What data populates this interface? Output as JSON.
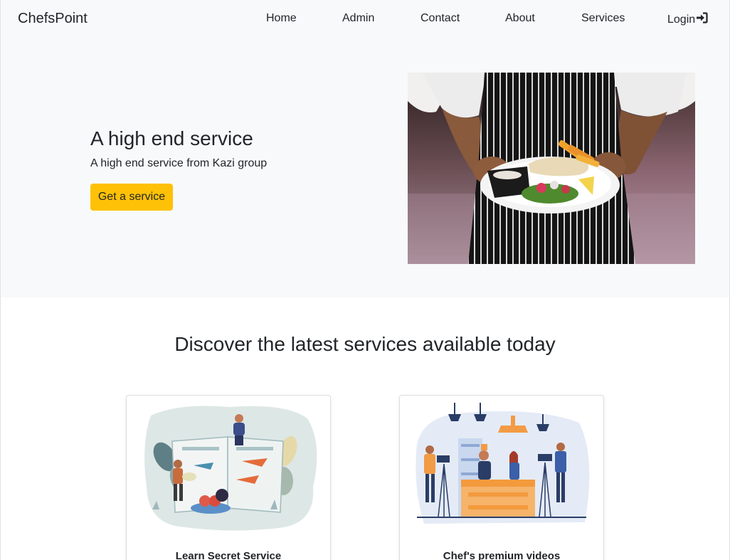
{
  "navbar": {
    "brand": "ChefsPoint",
    "items": [
      {
        "label": "Home"
      },
      {
        "label": "Admin"
      },
      {
        "label": "Contact"
      },
      {
        "label": "About"
      },
      {
        "label": "Services"
      },
      {
        "label": "Login",
        "icon": "sign-in-icon"
      }
    ]
  },
  "hero": {
    "title": "A high end service",
    "subtitle": "A high end service from Kazi group",
    "button_label": "Get a service",
    "image": "chef-holding-plate-photo"
  },
  "services": {
    "heading": "Discover the latest services available today",
    "cards": [
      {
        "title": "Learn Secret Service",
        "image": "recipe-book-illustration"
      },
      {
        "title": "Chef's premium videos",
        "image": "cooking-show-filming-illustration"
      }
    ]
  },
  "colors": {
    "accent": "#ffc107",
    "navbar_bg": "#f8f9fa",
    "text": "#212529"
  }
}
